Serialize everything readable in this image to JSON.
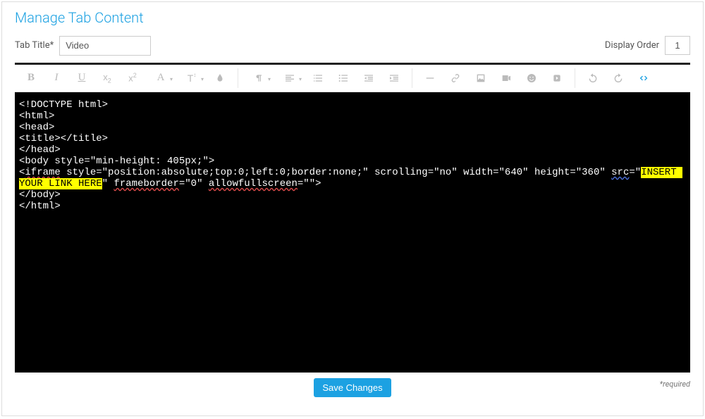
{
  "header": {
    "title": "Manage Tab Content"
  },
  "fields": {
    "tab_title_label": "Tab Title*",
    "tab_title_value": "Video",
    "display_order_label": "Display Order",
    "display_order_value": "1"
  },
  "toolbar": {
    "font_family_glyph": "A",
    "font_size_glyph": "T",
    "sub_glyph": "x",
    "sup_glyph": "x"
  },
  "code": {
    "line1": "<!DOCTYPE html>",
    "line2": "<html>",
    "line3": "<head>",
    "line4": "<title></title>",
    "line5": "</head>",
    "line6_a": "<body style=\"min-height: 405px;\">",
    "line7_a": "<",
    "line7_iframe": "iframe",
    "line7_b": " style=\"position:absolute;top:0;left:0;border:none;\" scrolling=\"no\" width=\"640\" height=\"360\" ",
    "line7_src": "src",
    "line7_c": "=\"",
    "line7_hl": "INSERT YOUR LINK HERE",
    "line7_d": "\" ",
    "line7_fb": "frameborder",
    "line7_e": "=\"0\" ",
    "line7_afs": "allowfullscreen",
    "line7_f": "=\"\">",
    "line8": "</body>",
    "line9": "</html>"
  },
  "footer": {
    "save_label": "Save Changes",
    "required_note": "*required"
  }
}
